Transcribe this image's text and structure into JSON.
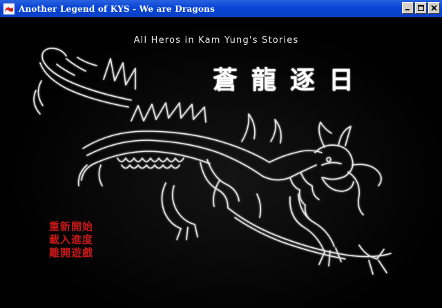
{
  "window": {
    "title": "Another Legend of KYS - We are Dragons",
    "icon": "dragon-app-icon",
    "buttons": [
      "minimize",
      "maximize",
      "close"
    ]
  },
  "title_screen": {
    "subtitle": "All Heros in Kam Yung's Stories",
    "logo_text": "蒼龍逐日",
    "menu": [
      {
        "label": "重新開始"
      },
      {
        "label": "載入進度"
      },
      {
        "label": "離開遊戲"
      }
    ],
    "menu_color": "#c81818",
    "artwork": "white-outline-chinese-dragon"
  }
}
